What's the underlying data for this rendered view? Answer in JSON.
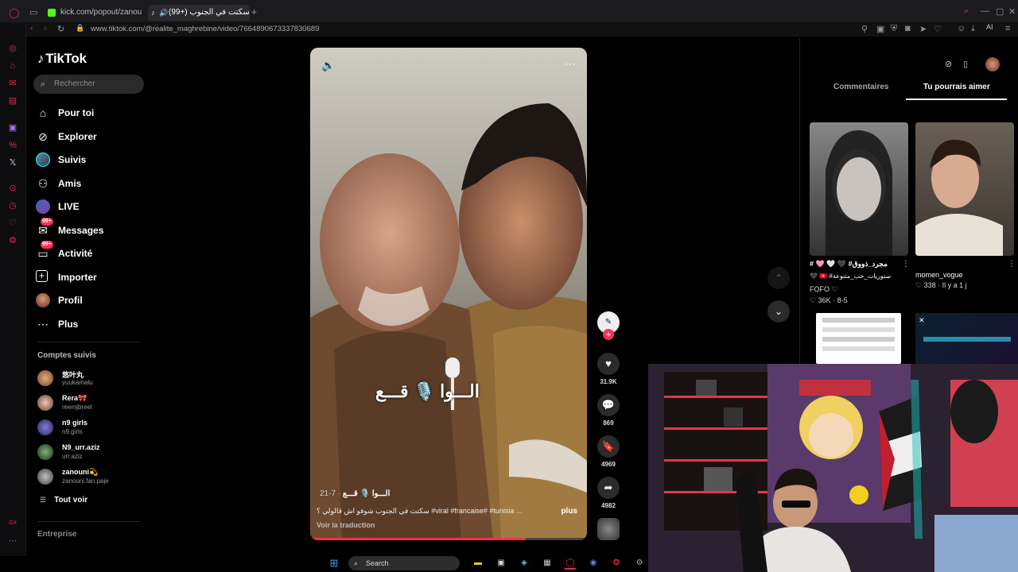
{
  "browser": {
    "tabs": [
      {
        "label": "kick.com/popout/zanouni/c"
      },
      {
        "label": "سكتت في الجنوب (+99)"
      }
    ],
    "url": "www.tiktok.com/@realite_maghrebine/video/7664890673337830689",
    "ai_label": "AI"
  },
  "tiktok": {
    "logo": "TikTok",
    "search_placeholder": "Rechercher",
    "nav": [
      {
        "label": "Pour toi",
        "icon": "home-icon"
      },
      {
        "label": "Explorer",
        "icon": "compass-icon"
      },
      {
        "label": "Suivis",
        "icon": "avatar-icon"
      },
      {
        "label": "Amis",
        "icon": "friends-icon"
      },
      {
        "label": "LIVE",
        "icon": "live-icon"
      },
      {
        "label": "Messages",
        "icon": "message-icon",
        "badge": "99+"
      },
      {
        "label": "Activité",
        "icon": "activity-icon",
        "badge": "99+"
      },
      {
        "label": "Importer",
        "icon": "plus-square-icon"
      },
      {
        "label": "Profil",
        "icon": "profile-avatar-icon"
      },
      {
        "label": "Plus",
        "icon": "more-dots-icon"
      }
    ],
    "following_header": "Comptes suivis",
    "following": [
      {
        "name": "悠叶丸",
        "handle": "yuukamalu"
      },
      {
        "name": "Rera🎀",
        "handle": "reemjbreel"
      },
      {
        "name": "n9 girls",
        "handle": "n9.girls"
      },
      {
        "name": "N9_urr.aziz",
        "handle": "urr.aziz"
      },
      {
        "name": "zanouni💫",
        "handle": "zanouni.fan.paje"
      }
    ],
    "see_all": "Tout voir",
    "footer": "Entreprise"
  },
  "video": {
    "overlay_text": "الـــوا 🎙️ قـــع",
    "username": "الـــوا 🎙️ قـــع",
    "date": "· 7-21",
    "caption": "سكتت في الجنوب شوفو اش قالولي ؟ #viral #francaise# #tunisia ...",
    "more": "plus",
    "translate": "Voir la traduction",
    "likes": "31.9K",
    "comments": "869",
    "saves": "4969",
    "shares": "4982"
  },
  "right_panel": {
    "tab_comments": "Commentaires",
    "tab_suggest": "Tu pourrais aimer",
    "cards": [
      {
        "title": "# 🩷 🤍 🖤 #مجرد_ذووق",
        "subtitle": "🖤 🇹🇳 #ستوريات_حب_متنوعة",
        "author": "FOFO ♡",
        "stats": "36K · 8-5"
      },
      {
        "title": "momen_vogue",
        "author": "",
        "stats": "338 · Il y a 1 j"
      }
    ]
  },
  "taskbar": {
    "search": "Search"
  },
  "colors": {
    "accent": "#fe2c55",
    "opera_red": "#e8284a",
    "bg": "#000000"
  }
}
